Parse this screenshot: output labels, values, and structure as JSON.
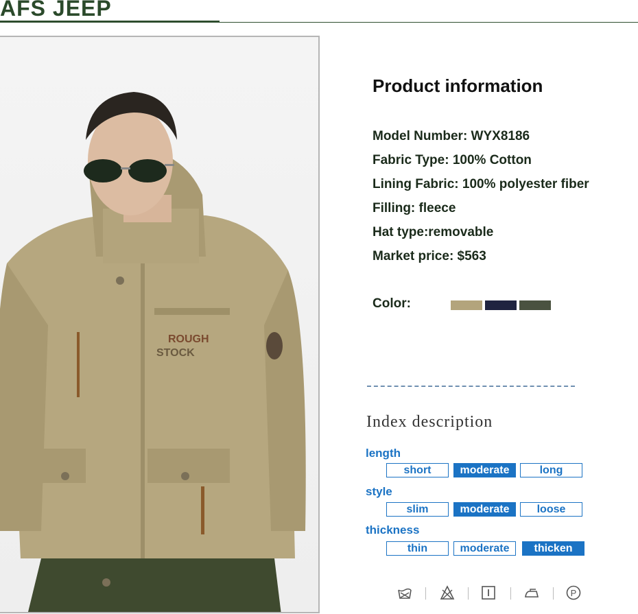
{
  "brand": {
    "name": "AFS JEEP"
  },
  "product_info": {
    "title": "Product  information",
    "specs": [
      "Model Number: WYX8186",
      "Fabric Type: 100% Cotton",
      "Lining Fabric: 100% polyester fiber",
      "Filling: fleece",
      "Hat type:removable",
      "Market price: $563"
    ],
    "color_label": "Color:",
    "colors": [
      "#b3a47c",
      "#1f2340",
      "#4a5240"
    ]
  },
  "photo": {
    "patch_text_1": "ROUGH",
    "patch_text_2": "STOCK"
  },
  "index_description": {
    "title": "Index description",
    "attributes": [
      {
        "label": "length",
        "options": [
          "short",
          "moderate",
          "long"
        ],
        "selected": "moderate"
      },
      {
        "label": "style",
        "options": [
          "slim",
          "moderate",
          "loose"
        ],
        "selected": "moderate"
      },
      {
        "label": "thickness",
        "options": [
          "thin",
          "moderate",
          "thicken"
        ],
        "selected": "thicken"
      }
    ]
  },
  "care_icons": [
    "hand-wash-icon",
    "no-bleach-icon",
    "tumble-dry-icon",
    "iron-icon",
    "dry-clean-icon"
  ]
}
